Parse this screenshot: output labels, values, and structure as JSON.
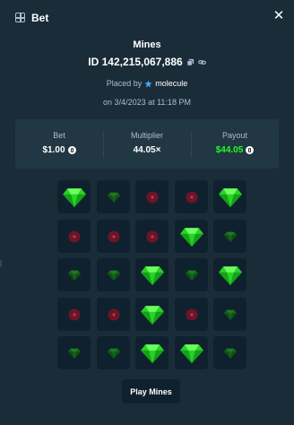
{
  "header": {
    "title": "Bet",
    "icon": "bet-icon",
    "close_icon": "close-icon"
  },
  "bet": {
    "game": "Mines",
    "id_text": "ID 142,215,067,886",
    "placed_by_label": "Placed by",
    "user": "molecule",
    "date": "on 3/4/2023 at 11:18 PM"
  },
  "stats": {
    "bet_label": "Bet",
    "bet_value": "$1.00",
    "multiplier_label": "Multiplier",
    "multiplier_value": "44.05×",
    "payout_label": "Payout",
    "payout_value": "$44.05"
  },
  "board": {
    "rows": [
      [
        "gem",
        "gem-dim",
        "mine",
        "mine",
        "gem"
      ],
      [
        "mine",
        "mine",
        "mine",
        "gem",
        "gem-dim"
      ],
      [
        "gem-dim",
        "gem-dim",
        "gem",
        "gem-dim",
        "gem"
      ],
      [
        "mine",
        "mine",
        "gem",
        "mine",
        "gem-dim"
      ],
      [
        "gem-dim",
        "gem-dim",
        "gem",
        "gem",
        "gem-dim"
      ]
    ]
  },
  "actions": {
    "play_label": "Play Mines"
  },
  "colors": {
    "background": "#1a2c38",
    "panel": "#213743",
    "tile": "#0f212e",
    "gem": "#2bff2c",
    "mine": "#7a1428",
    "payout": "#1fff20",
    "muted_text": "#b1bad3"
  }
}
